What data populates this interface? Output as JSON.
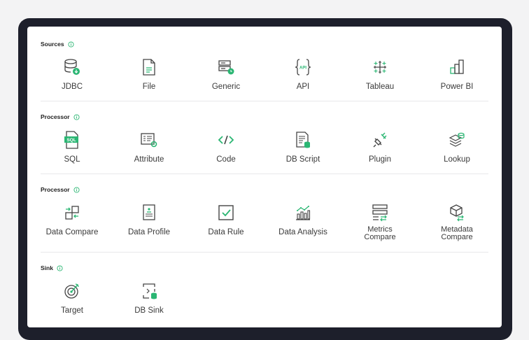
{
  "colors": {
    "accent": "#2bb673",
    "icon_stroke": "#444444",
    "frame": "#1d1f2b"
  },
  "sections": [
    {
      "title": "Sources",
      "items": [
        {
          "label": "JDBC",
          "icon": "database-icon"
        },
        {
          "label": "File",
          "icon": "file-icon"
        },
        {
          "label": "Generic",
          "icon": "generic-source-icon"
        },
        {
          "label": "API",
          "icon": "api-icon"
        },
        {
          "label": "Tableau",
          "icon": "tableau-icon"
        },
        {
          "label": "Power BI",
          "icon": "powerbi-icon"
        }
      ]
    },
    {
      "title": "Processor",
      "items": [
        {
          "label": "SQL",
          "icon": "sql-icon"
        },
        {
          "label": "Attribute",
          "icon": "attribute-icon"
        },
        {
          "label": "Code",
          "icon": "code-icon"
        },
        {
          "label": "DB Script",
          "icon": "db-script-icon"
        },
        {
          "label": "Plugin",
          "icon": "plugin-icon"
        },
        {
          "label": "Lookup",
          "icon": "lookup-icon"
        }
      ]
    },
    {
      "title": "Processor",
      "items": [
        {
          "label": "Data Compare",
          "icon": "data-compare-icon"
        },
        {
          "label": "Data Profile",
          "icon": "data-profile-icon"
        },
        {
          "label": "Data Rule",
          "icon": "data-rule-icon"
        },
        {
          "label": "Data Analysis",
          "icon": "data-analysis-icon"
        },
        {
          "label": "Metrics\nCompare",
          "icon": "metrics-compare-icon"
        },
        {
          "label": "Metadata\nCompare",
          "icon": "metadata-compare-icon"
        }
      ]
    },
    {
      "title": "Sink",
      "items": [
        {
          "label": "Target",
          "icon": "target-icon"
        },
        {
          "label": "DB Sink",
          "icon": "db-sink-icon"
        }
      ]
    }
  ]
}
